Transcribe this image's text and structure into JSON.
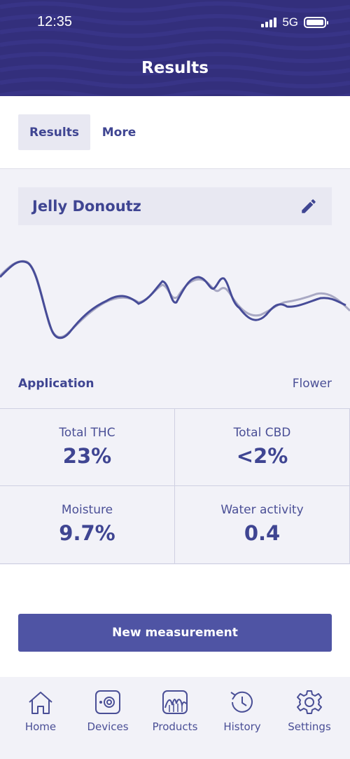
{
  "status_bar": {
    "time": "12:35",
    "network": "5G"
  },
  "header": {
    "title": "Results"
  },
  "tabs": [
    {
      "label": "Results",
      "active": true
    },
    {
      "label": "More",
      "active": false
    }
  ],
  "product": {
    "name": "Jelly Donoutz"
  },
  "application": {
    "label": "Application",
    "value": "Flower"
  },
  "metrics": [
    {
      "label": "Total THC",
      "value": "23%"
    },
    {
      "label": "Total CBD",
      "value": "<2%"
    },
    {
      "label": "Moisture",
      "value": "9.7%"
    },
    {
      "label": "Water activity",
      "value": "0.4"
    }
  ],
  "actions": {
    "new_measurement": "New measurement"
  },
  "bottom_nav": [
    {
      "label": "Home",
      "icon": "home-icon"
    },
    {
      "label": "Devices",
      "icon": "device-icon"
    },
    {
      "label": "Products",
      "icon": "products-icon"
    },
    {
      "label": "History",
      "icon": "history-icon"
    },
    {
      "label": "Settings",
      "icon": "gear-icon"
    }
  ],
  "colors": {
    "header": "#332f7c",
    "accent": "#4f54a4",
    "text": "#3f4592"
  }
}
